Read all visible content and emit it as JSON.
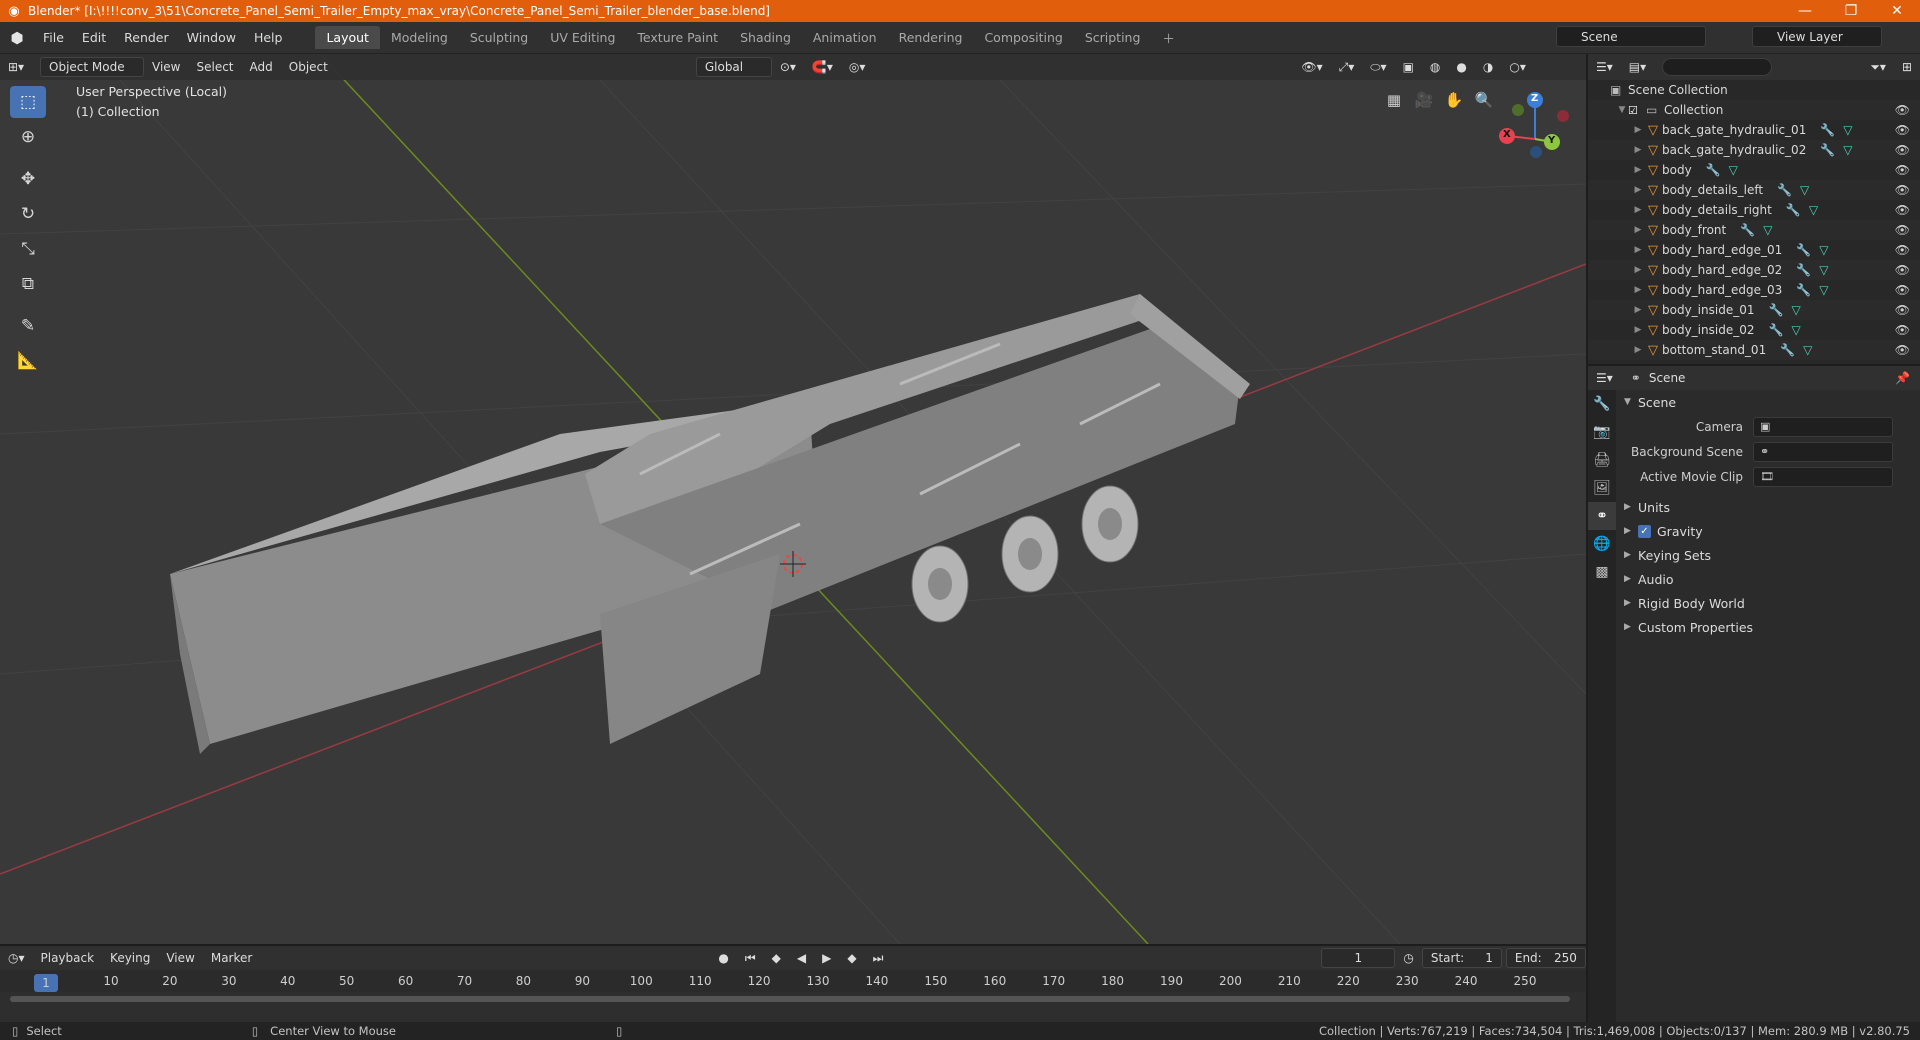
{
  "titlebar": {
    "title": "Blender* [I:\\!!!!conv_3\\51\\Concrete_Panel_Semi_Trailer_Empty_max_vray\\Concrete_Panel_Semi_Trailer_blender_base.blend]",
    "minimize": "—",
    "maximize": "❐",
    "close": "✕"
  },
  "menu": {
    "file": "File",
    "edit": "Edit",
    "render": "Render",
    "window": "Window",
    "help": "Help"
  },
  "workspaces": [
    "Layout",
    "Modeling",
    "Sculpting",
    "UV Editing",
    "Texture Paint",
    "Shading",
    "Animation",
    "Rendering",
    "Compositing",
    "Scripting"
  ],
  "scene_selector": "Scene",
  "view_layer": "View Layer",
  "viewport": {
    "mode": "Object Mode",
    "view": "View",
    "select": "Select",
    "add": "Add",
    "object": "Object",
    "orientation": "Global",
    "overlay_line1": "User Perspective (Local)",
    "overlay_line2": "(1) Collection"
  },
  "gizmo": {
    "x": "X",
    "y": "Y",
    "z": "Z"
  },
  "outliner": {
    "search_placeholder": "",
    "root": "Scene Collection",
    "collection": "Collection",
    "items": [
      "back_gate_hydraulic_01",
      "back_gate_hydraulic_02",
      "body",
      "body_details_left",
      "body_details_right",
      "body_front",
      "body_hard_edge_01",
      "body_hard_edge_02",
      "body_hard_edge_03",
      "body_inside_01",
      "body_inside_02",
      "bottom_stand_01"
    ]
  },
  "properties": {
    "context": "Scene",
    "section": "Scene",
    "camera_label": "Camera",
    "bg_scene_label": "Background Scene",
    "clip_label": "Active Movie Clip",
    "panels": [
      "Units",
      "Gravity",
      "Keying Sets",
      "Audio",
      "Rigid Body World",
      "Custom Properties"
    ]
  },
  "timeline": {
    "playback": "Playback",
    "keying": "Keying",
    "view": "View",
    "marker": "Marker",
    "current_frame": "1",
    "start_label": "Start:",
    "start": "1",
    "end_label": "End:",
    "end": "250",
    "ticks": [
      "10",
      "20",
      "30",
      "40",
      "50",
      "60",
      "70",
      "80",
      "90",
      "100",
      "110",
      "120",
      "130",
      "140",
      "150",
      "160",
      "170",
      "180",
      "190",
      "200",
      "210",
      "220",
      "230",
      "240",
      "250"
    ]
  },
  "status": {
    "select": "Select",
    "center": "Center View to Mouse",
    "stats": "Collection | Verts:767,219 | Faces:734,504 | Tris:1,469,008 | Objects:0/137 | Mem: 280.9 MB | v2.80.75"
  }
}
